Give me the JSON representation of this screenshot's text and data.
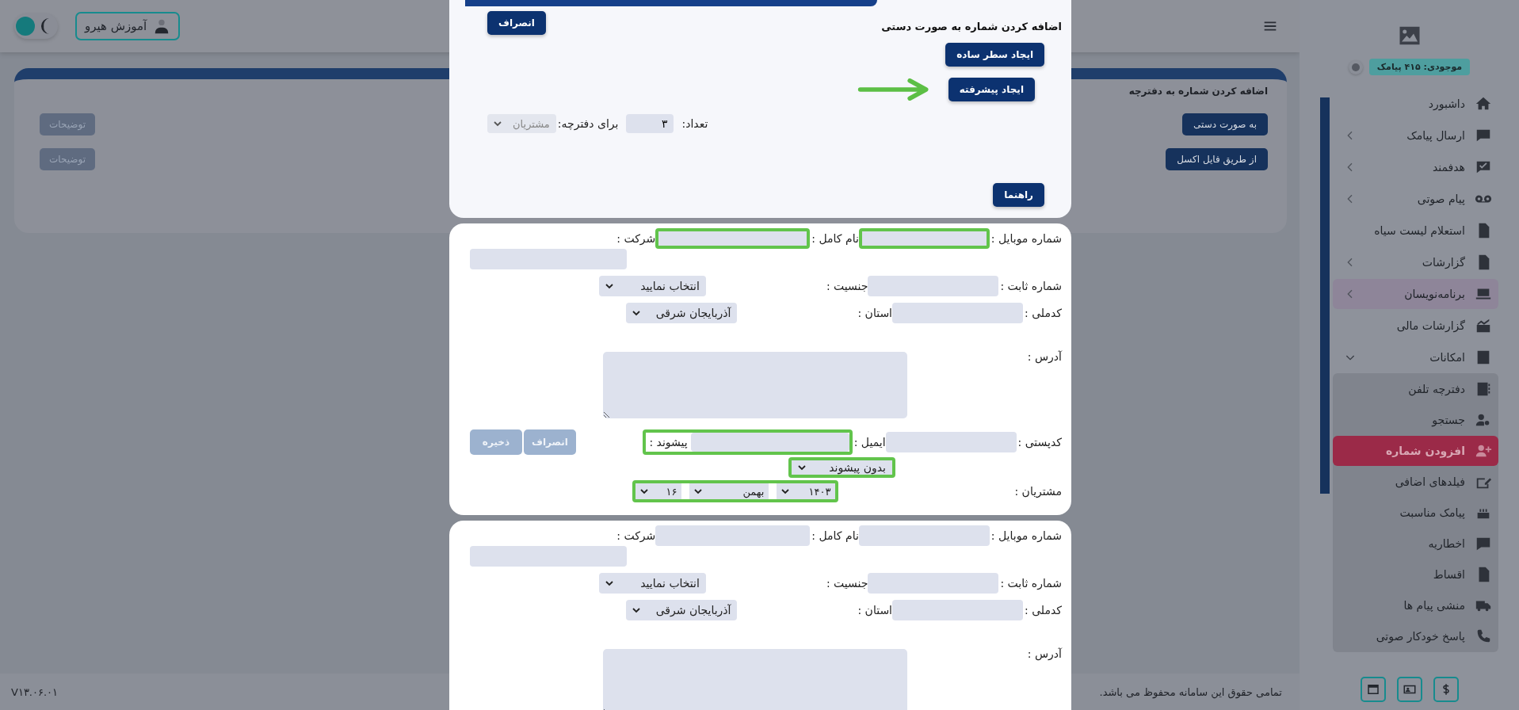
{
  "header": {
    "user_button": "آموزش هیرو",
    "light_mode": false
  },
  "card": {
    "title": "اضافه کردن شماره به دفترچه",
    "rows": [
      {
        "action": "به صورت دستی",
        "note": "توضیحات"
      },
      {
        "action": "از طریق فایل اکسل",
        "note": "توضیحات"
      }
    ]
  },
  "footer": {
    "copyright": "تمامی حقوق این سامانه محفوظ می باشد.",
    "version": "V۱۳.۰۶.۰۱"
  },
  "sidebar": {
    "balance": "موجودی: ۴۱۵ پیامک",
    "items": [
      {
        "label": "داشبورد",
        "selected": false,
        "highlighted": false
      },
      {
        "label": "ارسال پیامک",
        "expanded": false,
        "selected": false,
        "highlighted": false
      },
      {
        "label": "هدفمند",
        "expanded": false,
        "selected": false,
        "highlighted": false
      },
      {
        "label": "پیام صوتی",
        "expanded": false,
        "selected": false,
        "highlighted": false
      },
      {
        "label": "استعلام لیست سیاه",
        "selected": false,
        "highlighted": false
      },
      {
        "label": "گزارشات",
        "expanded": false,
        "selected": false,
        "highlighted": false
      },
      {
        "label": "برنامه‌نویسان",
        "expanded": false,
        "selected": false,
        "highlighted": true
      },
      {
        "label": "گزارشات مالی",
        "selected": false,
        "highlighted": false
      },
      {
        "label": "امکانات",
        "expanded": true,
        "selected": false,
        "highlighted": false,
        "children": [
          {
            "label": "دفترچه تلفن",
            "selected": false
          },
          {
            "label": "جستجو",
            "selected": false
          },
          {
            "label": "افزودن شماره",
            "selected": true
          },
          {
            "label": "فیلدهای اضافی",
            "selected": false
          },
          {
            "label": "پیامک مناسبت",
            "selected": false
          },
          {
            "label": "اخطاریه",
            "selected": false
          },
          {
            "label": "اقساط",
            "selected": false
          },
          {
            "label": "منشی پیام ها",
            "selected": false
          },
          {
            "label": "پاسخ خودکار صوتی",
            "selected": false
          }
        ]
      }
    ]
  },
  "modal": {
    "title": "اضافه کردن شماره به صورت دستی",
    "cancel": "انصراف",
    "simple_row": "ایجاد سطر ساده",
    "advanced": "ایجاد پیشرفته",
    "count_label": "تعداد:",
    "count_value": "۳",
    "phonebook_label": "برای دفترچه:",
    "phonebook_value": "مشتریان",
    "help": "راهنما"
  },
  "records": [
    {
      "rows": [
        {
          "fields": [
            {
              "kind": "input",
              "label": "شماره موبایل :",
              "highlighted": true
            },
            {
              "kind": "input",
              "label": "نام کامل :",
              "highlighted": true
            },
            {
              "kind": "input",
              "label": "شرکت :",
              "highlighted": false
            }
          ]
        },
        {
          "fields": [
            {
              "kind": "input",
              "label": "شماره ثابت :",
              "highlighted": false
            },
            {
              "kind": "select",
              "label": "جنسیت :",
              "value": "انتخاب نمایید",
              "highlighted": false
            }
          ]
        },
        {
          "fields": [
            {
              "kind": "input",
              "label": "کدملی :",
              "highlighted": false
            },
            {
              "kind": "select",
              "label": "استان :",
              "value": "آذربایجان شرقی",
              "highlighted": false
            }
          ]
        },
        {
          "fields": [
            {
              "kind": "textarea",
              "label": "آدرس :",
              "highlighted": false
            }
          ]
        },
        {
          "fields": [
            {
              "kind": "input",
              "label": "کدپستی :",
              "highlighted": false
            },
            {
              "kind": "email",
              "label": "ایمیل :",
              "prefix_label": "پیشوند :",
              "highlighted": true
            }
          ],
          "actions": [
            {
              "label": "انصراف",
              "disabled": true
            },
            {
              "label": "ذخیره",
              "disabled": true
            }
          ]
        },
        {
          "fields": [
            {
              "kind": "select",
              "value": "بدون پیشوند",
              "highlighted": true
            }
          ]
        },
        {
          "fields": [
            {
              "kind": "date",
              "label": "مشتریان :",
              "parts": [
                "۱۴۰۳",
                "بهمن",
                "۱۶"
              ],
              "highlighted": true
            }
          ]
        }
      ]
    },
    {
      "rows": [
        {
          "fields": [
            {
              "kind": "input",
              "label": "شماره موبایل :",
              "highlighted": false
            },
            {
              "kind": "input",
              "label": "نام کامل :",
              "highlighted": false
            },
            {
              "kind": "input",
              "label": "شرکت :",
              "highlighted": false
            }
          ]
        },
        {
          "fields": [
            {
              "kind": "input",
              "label": "شماره ثابت :",
              "highlighted": false
            },
            {
              "kind": "select",
              "label": "جنسیت :",
              "value": "انتخاب نمایید",
              "highlighted": false
            }
          ]
        },
        {
          "fields": [
            {
              "kind": "input",
              "label": "کدملی :",
              "highlighted": false
            },
            {
              "kind": "select",
              "label": "استان :",
              "value": "آذربایجان شرقی",
              "highlighted": false
            }
          ]
        },
        {
          "fields": [
            {
              "kind": "textarea",
              "label": "آدرس :",
              "highlighted": false
            }
          ]
        }
      ]
    }
  ]
}
